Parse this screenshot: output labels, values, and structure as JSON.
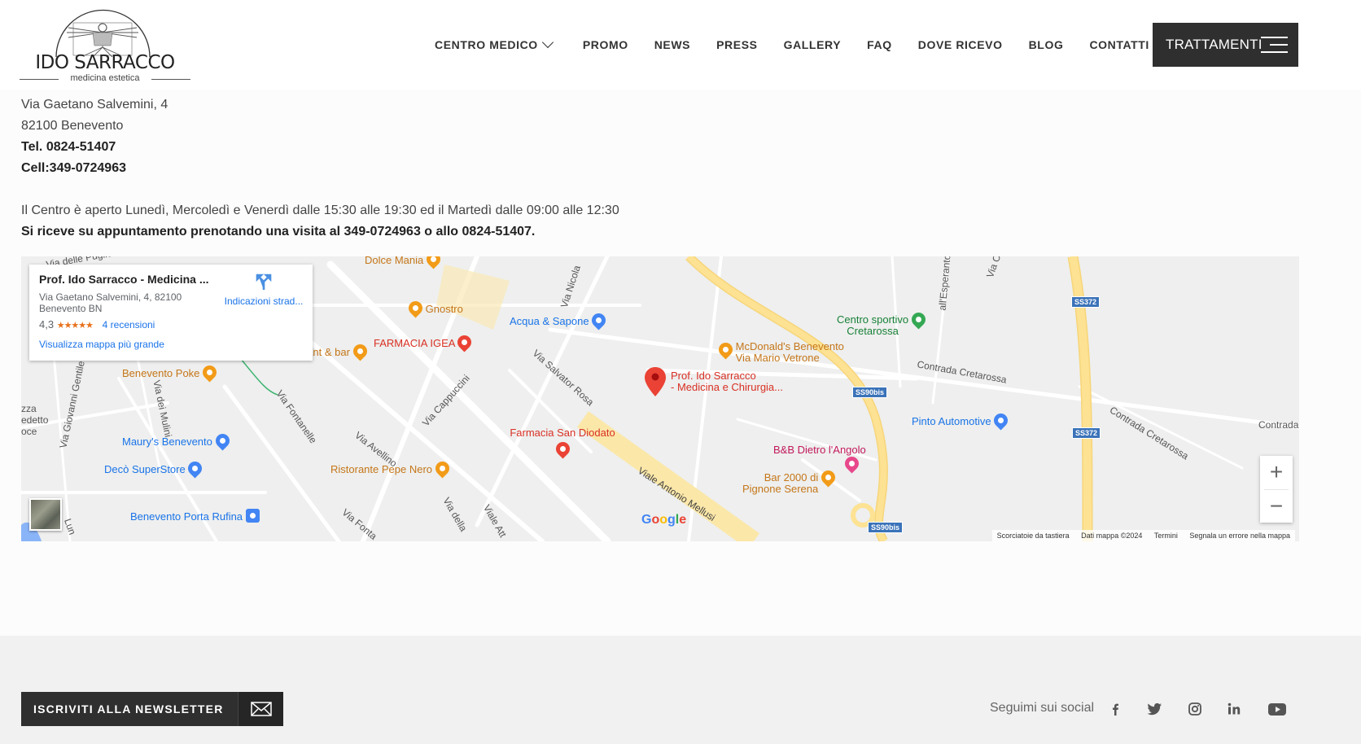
{
  "header": {
    "logo_name": "IDO SARRACCO",
    "logo_sub": "medicina estetica",
    "nav": [
      {
        "label": "CENTRO MEDICO",
        "dropdown": true
      },
      {
        "label": "PROMO",
        "dropdown": false
      },
      {
        "label": "NEWS",
        "dropdown": false
      },
      {
        "label": "PRESS",
        "dropdown": false
      },
      {
        "label": "GALLERY",
        "dropdown": false
      },
      {
        "label": "FAQ",
        "dropdown": false
      },
      {
        "label": "DOVE RICEVO",
        "dropdown": false
      },
      {
        "label": "BLOG",
        "dropdown": false
      },
      {
        "label": "CONTATTI",
        "dropdown": true
      }
    ],
    "cta_label": "TRATTAMENTI"
  },
  "contact": {
    "address_line1": "Via Gaetano Salvemini, 4",
    "address_line2": "82100 Benevento",
    "tel": "Tel. 0824-51407",
    "cell": "Cell:349-0724963",
    "hours": "Il Centro è aperto Lunedì, Mercoledì e Venerdì dalle 15:30 alle 19:30 ed il Martedì dalle 09:00 alle 12:30",
    "appointment": "Si riceve su appuntamento prenotando una visita al 349-0724963 o allo 0824-51407."
  },
  "map": {
    "card": {
      "title": "Prof. Ido Sarracco - Medicina ...",
      "address": "Via Gaetano Salvemini, 4, 82100 Benevento BN",
      "rating": "4,3",
      "stars": "★★★★★",
      "reviews": "4 recensioni",
      "bigger_map": "Visualizza mappa più grande",
      "directions": "Indicazioni strad..."
    },
    "pois": {
      "dolce_mania": "Dolce Mania",
      "gnostro": "Gnostro",
      "acqua_sapone": "Acqua & Sapone",
      "farmacia_igea": "FARMACIA IGEA",
      "dada": "Dada restaurant & bar",
      "benevento_poke": "Benevento Poke",
      "maurys": "Maury's Benevento",
      "deco": "Decò SuperStore",
      "porta_rufina": "Benevento Porta Rufina",
      "pepe_nero": "Ristorante Pepe Nero",
      "san_diodato": "Farmacia San Diodato",
      "mcdonalds": "McDonald's Benevento Via Mario Vetrone",
      "mcdonalds_1": "McDonald's Benevento",
      "mcdonalds_2": "Via Mario Vetrone",
      "sarracco_1": "Prof. Ido Sarracco",
      "sarracco_2": "- Medicina e Chirurgia...",
      "bb": "B&B Dietro l'Angolo",
      "bar2000_1": "Bar 2000 di",
      "bar2000_2": "Pignone Serena",
      "centro_sportivo_1": "Centro sportivo",
      "centro_sportivo_2": "Cretarossa",
      "pinto": "Pinto Automotive"
    },
    "streets": {
      "via_nicola": "Via Nicola",
      "via_salvator_rosa": "Via Salvator Rosa",
      "via_cappuccini": "Via Cappuccini",
      "via_fontanelle": "Via Fontanelle",
      "via_avellino": "Via Avellino",
      "via_giovanni_gentile": "Via Giovanni Gentile",
      "via_dei_mulini": "Via dei Mulini",
      "viale_antonio_mellusi": "Viale Antonio Mellusi",
      "contrada_cretarossa": "Contrada Cretarossa",
      "contrada_cretarossa_2": "Contrada Cretarossa",
      "contrada": "Contrada",
      "via_delle_puglie": "Via delle Puglie",
      "zza_edetto_oce": "zza\nedetto\noce",
      "esperanto": "all'Esperanto",
      "via_dt": "Via della",
      "viale_att": "Viale Att",
      "via_fonta": "Via Fonta",
      "lun": "Lun",
      "via_c": "Via C"
    },
    "shields": [
      "SS372",
      "SS90bis",
      "SS372",
      "SS90bis"
    ],
    "google": "Google",
    "attribution": [
      "Scorciatoie da tastiera",
      "Dati mappa ©2024",
      "Termini",
      "Segnala un errore nella mappa"
    ]
  },
  "footer": {
    "newsletter_label": "ISCRIVITI ALLA NEWSLETTER",
    "social_label": "Seguimi sui social",
    "socials": [
      "facebook-icon",
      "twitter-icon",
      "instagram-icon",
      "linkedin-icon",
      "youtube-icon"
    ]
  }
}
